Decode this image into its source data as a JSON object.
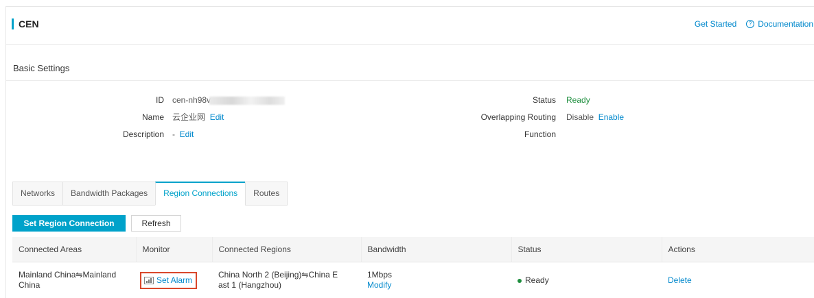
{
  "header": {
    "title": "CEN",
    "get_started": "Get Started",
    "documentation": "Documentation",
    "documentation_icon": "question-circle-icon"
  },
  "basic_settings": {
    "title": "Basic Settings",
    "id_label": "ID",
    "id_value": "cen-nh98v",
    "name_label": "Name",
    "name_value": "云企业网",
    "name_edit": "Edit",
    "description_label": "Description",
    "description_value": "-",
    "description_edit": "Edit",
    "status_label": "Status",
    "status_value": "Ready",
    "overlapping_label": "Overlapping Routing",
    "overlapping_value": "Disable",
    "overlapping_action": "Enable",
    "function_label": "Function"
  },
  "tabs": [
    "Networks",
    "Bandwidth Packages",
    "Region Connections",
    "Routes"
  ],
  "active_tab": "Region Connections",
  "toolbar": {
    "primary": "Set Region Connection",
    "refresh": "Refresh"
  },
  "table": {
    "columns": [
      "Connected Areas",
      "Monitor",
      "Connected Regions",
      "Bandwidth",
      "Status",
      "Actions"
    ],
    "rows": [
      {
        "areas_line1": "Mainland China⇋Mainland",
        "areas_line2": "China",
        "monitor": "Set Alarm",
        "regions_line1": "China North 2 (Beijing)⇋China E",
        "regions_line2": "ast 1 (Hangzhou)",
        "bandwidth": "1Mbps",
        "bandwidth_action": "Modify",
        "status": "Ready",
        "action": "Delete"
      }
    ]
  },
  "colors": {
    "accent": "#00a2ca",
    "link": "#0088cc",
    "ready": "#1e8e3e",
    "highlight": "#d9472b"
  }
}
